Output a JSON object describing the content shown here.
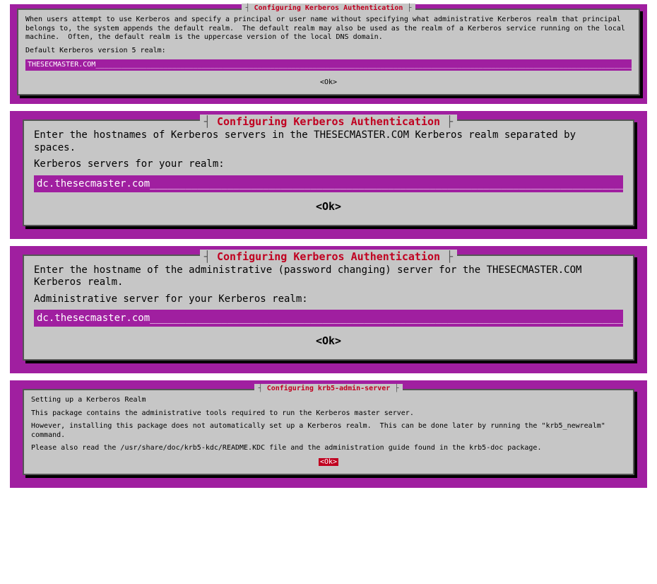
{
  "colors": {
    "accent": "#a01fa0",
    "title": "#c00020",
    "panel": "#c6c6c6"
  },
  "dialogs": [
    {
      "id": "realm",
      "title": "Configuring Kerberos Authentication",
      "body": "When users attempt to use Kerberos and specify a principal or user name without specifying what administrative Kerberos realm that principal belongs to, the system appends the default realm.  The default realm may also be used as the realm of a Kerberos service running on the local machine.  Often, the default realm is the uppercase version of the local DNS domain.",
      "prompt": "Default Kerberos version 5 realm:",
      "input": "THESECMASTER.COM",
      "ok": "<Ok>",
      "ok_highlight": false,
      "size": "small"
    },
    {
      "id": "servers",
      "title": "Configuring Kerberos Authentication",
      "body": "Enter the hostnames of Kerberos servers in the THESECMASTER.COM Kerberos realm separated by spaces.",
      "prompt": "Kerberos servers for your realm:",
      "input": "dc.thesecmaster.com",
      "ok": "<Ok>",
      "ok_highlight": false,
      "size": "big"
    },
    {
      "id": "admin",
      "title": "Configuring Kerberos Authentication",
      "body": "Enter the hostname of the administrative (password changing) server for the THESECMASTER.COM Kerberos realm.",
      "prompt": "Administrative server for your Kerberos realm:",
      "input": "dc.thesecmaster.com",
      "ok": "<Ok>",
      "ok_highlight": false,
      "size": "big"
    },
    {
      "id": "krb5admin",
      "title": "Configuring krb5-admin-server",
      "paragraphs": [
        "Setting up a Kerberos Realm",
        "This package contains the administrative tools required to run the Kerberos master server.",
        "However, installing this package does not automatically set up a Kerberos realm.  This can be done later by running the \"krb5_newrealm\" command.",
        "Please also read the /usr/share/doc/krb5-kdc/README.KDC file and the administration guide found in the krb5-doc package."
      ],
      "ok": "<Ok>",
      "ok_highlight": true,
      "size": "small"
    }
  ]
}
